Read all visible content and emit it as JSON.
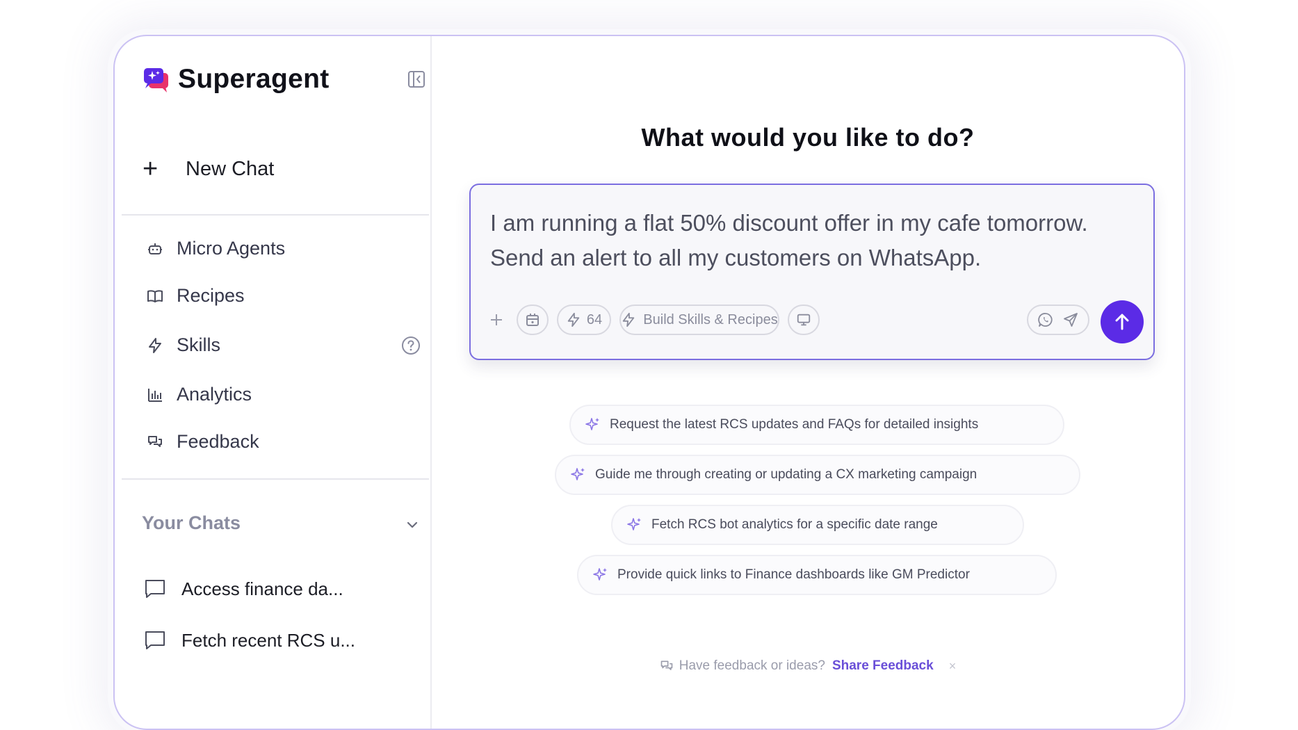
{
  "app": {
    "name": "Superagent"
  },
  "sidebar": {
    "new_chat_label": "New Chat",
    "items": [
      {
        "label": "Micro Agents",
        "icon": "bot-icon"
      },
      {
        "label": "Recipes",
        "icon": "book-icon"
      },
      {
        "label": "Skills",
        "icon": "lightning-icon"
      },
      {
        "label": "Analytics",
        "icon": "bar-chart-icon"
      },
      {
        "label": "Feedback",
        "icon": "chat-bubbles-icon"
      }
    ],
    "your_chats_title": "Your Chats",
    "chats": [
      {
        "label": "Access finance da..."
      },
      {
        "label": "Fetch recent RCS u..."
      }
    ]
  },
  "main": {
    "headline": "What would you like to do?",
    "composer": {
      "text": "I am running a flat 50% discount offer in my cafe tomorrow. Send an alert to all my  customers on WhatsApp.",
      "skills_count": "64",
      "build_label": "Build Skills & Recipes"
    },
    "suggestions": [
      "Request the latest RCS updates and FAQs for detailed insights",
      "Guide me through creating or updating a CX marketing campaign",
      "Fetch RCS bot analytics for a specific date range",
      "Provide quick links to Finance dashboards like GM Predictor"
    ],
    "feedback": {
      "prompt": "Have feedback or ideas?",
      "link": "Share Feedback",
      "dismiss": "×"
    }
  },
  "colors": {
    "accent": "#5b2be6",
    "border": "#7b6ee0",
    "link": "#6a4fd8"
  }
}
